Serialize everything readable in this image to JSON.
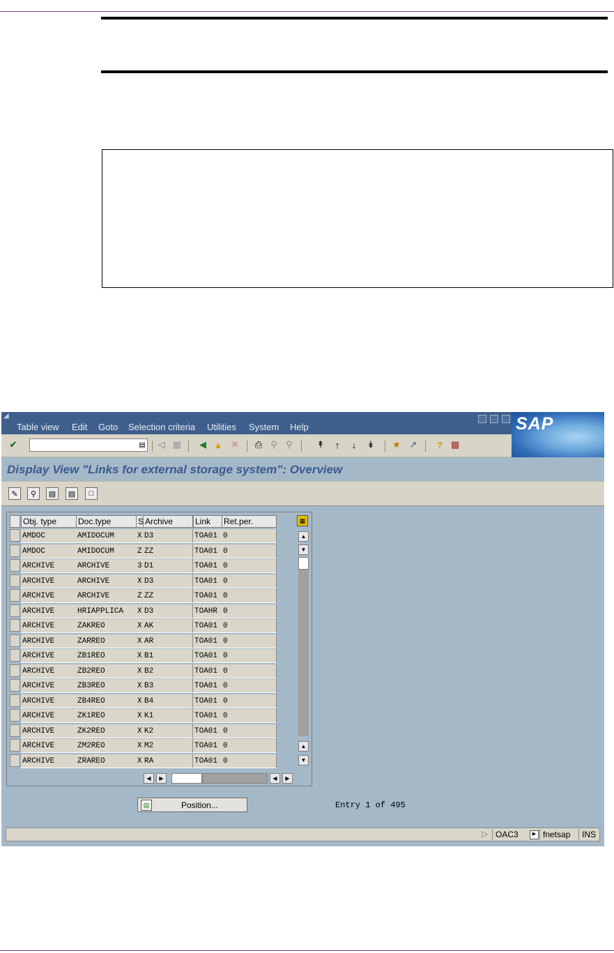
{
  "menu": {
    "items": [
      "Table view",
      "Edit",
      "Goto",
      "Selection criteria",
      "Utilities",
      "System",
      "Help"
    ],
    "mnemonic_first": [
      "T",
      "E",
      "G",
      "S",
      "U",
      "S",
      "H"
    ]
  },
  "logo": "SAP",
  "title": "Display View \"Links for external storage system\": Overview",
  "table": {
    "headers": [
      "Obj. type",
      "Doc.type",
      "S",
      "Archive",
      "Link",
      "Ret.per."
    ],
    "rows": [
      [
        "AMDOC",
        "AMIDOCUM",
        "X",
        "D3",
        "TOA01",
        "0"
      ],
      [
        "AMDOC",
        "AMIDOCUM",
        "Z",
        "ZZ",
        "TOA01",
        "0"
      ],
      [
        "ARCHIVE",
        "ARCHIVE",
        "3",
        "D1",
        "TOA01",
        "0"
      ],
      [
        "ARCHIVE",
        "ARCHIVE",
        "X",
        "D3",
        "TOA01",
        "0"
      ],
      [
        "ARCHIVE",
        "ARCHIVE",
        "Z",
        "ZZ",
        "TOA01",
        "0"
      ],
      [
        "ARCHIVE",
        "HRIAPPLICA",
        "X",
        "D3",
        "TOAHR",
        "0"
      ],
      [
        "ARCHIVE",
        "ZAKREO",
        "X",
        "AK",
        "TOA01",
        "0"
      ],
      [
        "ARCHIVE",
        "ZARREO",
        "X",
        "AR",
        "TOA01",
        "0"
      ],
      [
        "ARCHIVE",
        "ZB1REO",
        "X",
        "B1",
        "TOA01",
        "0"
      ],
      [
        "ARCHIVE",
        "ZB2REO",
        "X",
        "B2",
        "TOA01",
        "0"
      ],
      [
        "ARCHIVE",
        "ZB3REO",
        "X",
        "B3",
        "TOA01",
        "0"
      ],
      [
        "ARCHIVE",
        "ZB4REO",
        "X",
        "B4",
        "TOA01",
        "0"
      ],
      [
        "ARCHIVE",
        "ZK1REO",
        "X",
        "K1",
        "TOA01",
        "0"
      ],
      [
        "ARCHIVE",
        "ZK2REO",
        "X",
        "K2",
        "TOA01",
        "0"
      ],
      [
        "ARCHIVE",
        "ZM2REO",
        "X",
        "M2",
        "TOA01",
        "0"
      ],
      [
        "ARCHIVE",
        "ZRAREO",
        "X",
        "RA",
        "TOA01",
        "0"
      ]
    ]
  },
  "position_button": "Position...",
  "entry_text": "Entry 1 of 495",
  "status": {
    "transaction": "OAC3",
    "server": "fnetsap",
    "mode": "INS"
  },
  "colors": {
    "menubar": "#3e5f8c",
    "background": "#a4b8c8",
    "title": "#3c5a8f",
    "toolbar": "#d8d4c7"
  }
}
